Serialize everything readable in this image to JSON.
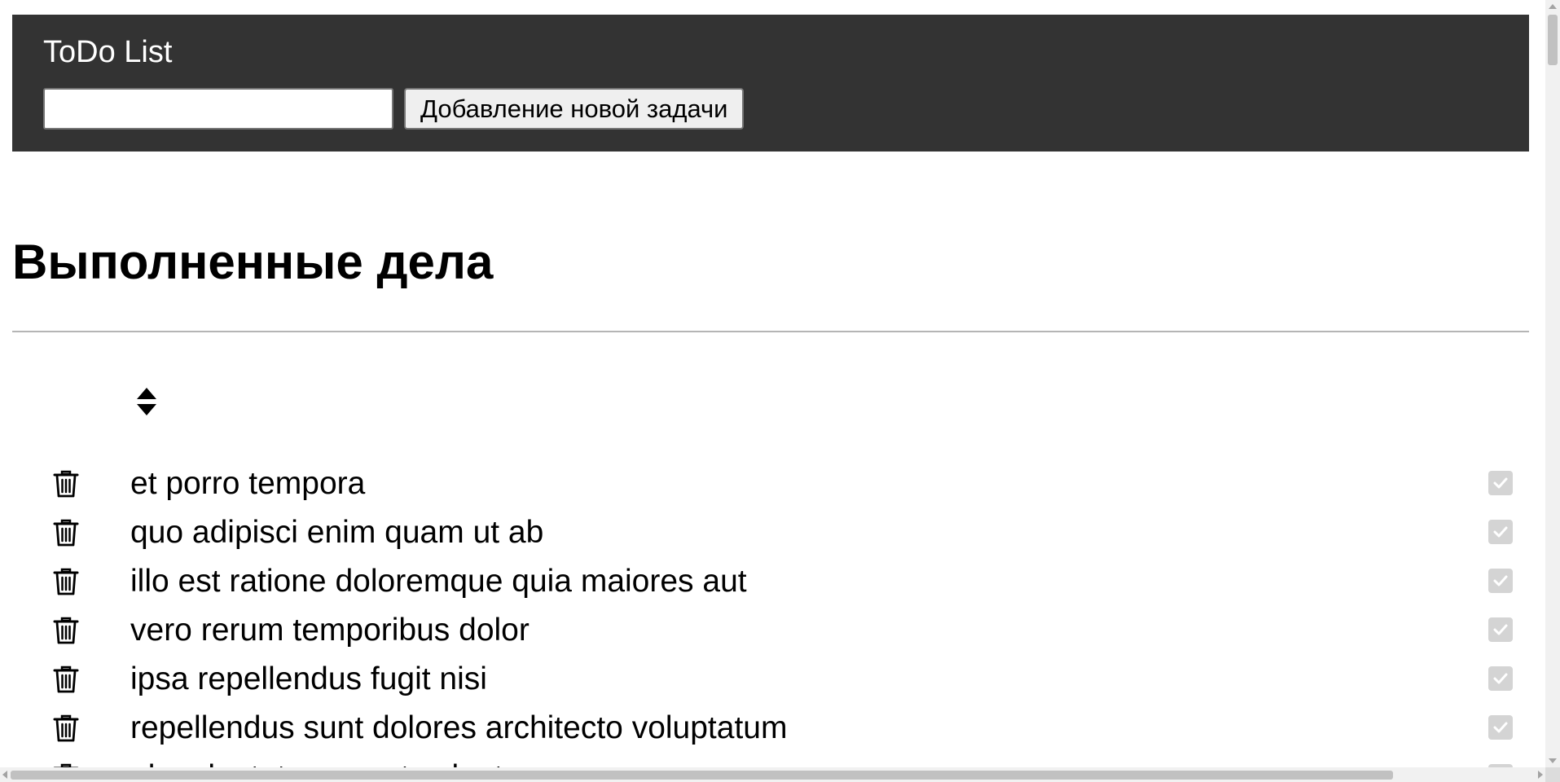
{
  "header": {
    "title": "ToDo List",
    "input_value": "",
    "input_placeholder": "",
    "add_button_label": "Добавление новой задачи",
    "background": "#333333"
  },
  "section": {
    "title": "Выполненные дела",
    "sort_icon": "sort-icon"
  },
  "tasks": [
    {
      "text": "et porro tempora",
      "completed": true,
      "delete_icon": "trash-icon"
    },
    {
      "text": "quo adipisci enim quam ut ab",
      "completed": true,
      "delete_icon": "trash-icon"
    },
    {
      "text": "illo est ratione doloremque quia maiores aut",
      "completed": true,
      "delete_icon": "trash-icon"
    },
    {
      "text": "vero rerum temporibus dolor",
      "completed": true,
      "delete_icon": "trash-icon"
    },
    {
      "text": "ipsa repellendus fugit nisi",
      "completed": true,
      "delete_icon": "trash-icon"
    },
    {
      "text": "repellendus sunt dolores architecto voluptatum",
      "completed": true,
      "delete_icon": "trash-icon"
    },
    {
      "text": "ab voluptatum amet voluptas",
      "completed": true,
      "delete_icon": "trash-icon"
    }
  ]
}
